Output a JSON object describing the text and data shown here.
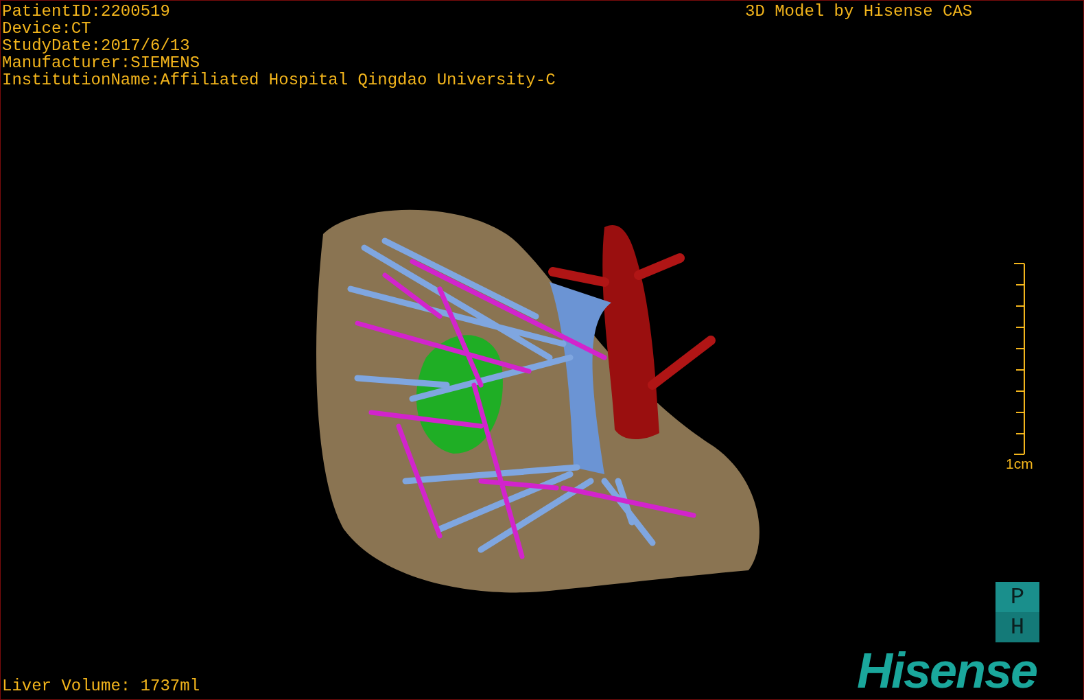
{
  "header_info": [
    "PatientID:2200519",
    "Device:CT",
    "StudyDate:2017/6/13",
    "Manufacturer:SIEMENS",
    "InstitutionName:Affiliated Hospital Qingdao University-C"
  ],
  "caption": "3D Model by Hisense CAS",
  "scale": {
    "label": "1cm"
  },
  "orientation_cube": {
    "top": "P",
    "bottom": "H"
  },
  "logo": "Hisense",
  "footer": "Liver Volume: 1737ml"
}
